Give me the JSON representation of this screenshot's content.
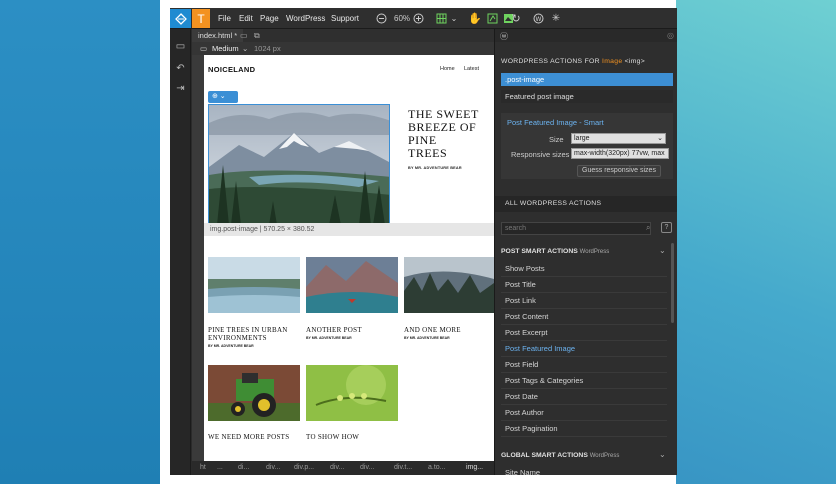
{
  "menu": {
    "file": "File",
    "edit": "Edit",
    "page": "Page",
    "wordpress": "WordPress",
    "support": "Support",
    "zoom": "60%"
  },
  "editor": {
    "tab": "index.html",
    "device": "Medium",
    "width": "1024 px"
  },
  "site": {
    "brand": "NOICELAND",
    "nav": [
      "Home",
      "Latest"
    ],
    "hero_title": "THE SWEET\nBREEZE OF PINE\nTREES",
    "hero_by": "BY MR. ADVENTURE BEAR",
    "selected_size": "img.post-image | 570.25 × 380.52",
    "cards": [
      {
        "title": "PINE TREES IN URBAN ENVIRONMENTS",
        "by": "BY MR. ADVENTURE BEAR"
      },
      {
        "title": "ANOTHER POST",
        "by": "BY MR. ADVENTURE BEAR"
      },
      {
        "title": "AND ONE MORE",
        "by": "BY MR. ADVENTURE BEAR"
      },
      {
        "title": "WE NEED MORE POSTS",
        "by": ""
      },
      {
        "title": "TO SHOW HOW",
        "by": ""
      }
    ]
  },
  "breadcrumbs": [
    "ht",
    "...",
    "di...",
    "div...",
    "div.p...",
    "div...",
    "div...",
    "div.t...",
    "a.to...",
    "img..."
  ],
  "panel": {
    "header_prefix": "WORDPRESS ACTIONS FOR",
    "header_target": "Image",
    "header_tag": "<img>",
    "selector_active": ".post-image",
    "selector_other": "Featured post image",
    "smart_title": "Post Featured Image - Smart",
    "size_label": "Size",
    "size_value": "large",
    "responsive_label": "Responsive sizes",
    "responsive_value": "max-width(320px) 77vw, max",
    "guess_button": "Guess responsive sizes",
    "all_actions": "ALL WORDPRESS ACTIONS",
    "search_placeholder": "search",
    "post_group": "POST SMART ACTIONS",
    "post_group_tag": "WordPress",
    "post_items": [
      "Show Posts",
      "Post Title",
      "Post Link",
      "Post Content",
      "Post Excerpt",
      "Post Featured Image",
      "Post Field",
      "Post Tags & Categories",
      "Post Date",
      "Post Author",
      "Post Pagination"
    ],
    "global_group": "GLOBAL SMART ACTIONS",
    "global_group_tag": "WordPress",
    "global_items": [
      "Site Name"
    ]
  },
  "colors": {
    "accent": "#3b8fd5",
    "orange": "#f39220",
    "active_item": "#6cb3f0"
  }
}
